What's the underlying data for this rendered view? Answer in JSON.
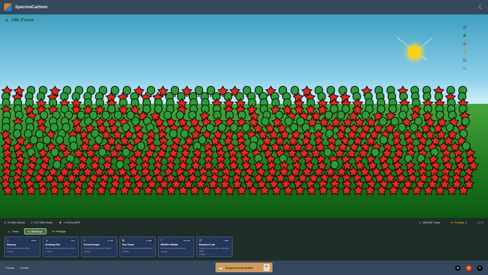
{
  "app": {
    "name": "SparrowCartoon",
    "theme_icon": "moon-icon"
  },
  "scene": {
    "title": "Idle Forest",
    "workers": [
      "lumberjack-icon",
      "forester-icon",
      "gatherer-icon",
      "sapling-icon",
      "ranger-icon",
      "scientist-icon"
    ],
    "tree_colors": {
      "green": "#2d9b3a",
      "red": "#e02a1e",
      "outline": "#0b0b0b"
    }
  },
  "stats": {
    "seeds": "72.09M Seeds",
    "wood": "127.94M Wood",
    "wps": "1.97M/s WPS",
    "trees": "300/300 Trees",
    "prestige": "Prestige 0",
    "prestige_bonus": "+1.97"
  },
  "tabs": [
    {
      "label": "Trees",
      "icon": "tree-icon",
      "active": false
    },
    {
      "label": "Buildings",
      "icon": "building-icon",
      "active": true
    },
    {
      "label": "Prestige",
      "icon": "star-icon",
      "active": false
    }
  ],
  "buildings": [
    {
      "icon": "nursery-icon",
      "name": "Nursery",
      "desc": "Grows saplings over time",
      "cost": "35.0K",
      "owned": "x1.00/s"
    },
    {
      "icon": "sapling-icon",
      "name": "Seeding Plot",
      "desc": "Plants seeds to yield more wood",
      "cost": "2.1M",
      "owned": "x1.01/s"
    },
    {
      "icon": "keeper-icon",
      "name": "Forest Keeper",
      "desc": "Tends forest so it grows faster",
      "cost": "10.4M",
      "owned": "x1.01/s"
    },
    {
      "icon": "ray-icon",
      "name": "Sun Tower",
      "desc": "Boosts photosynthesis of all trees",
      "cost": "42.8M",
      "owned": "x1.00/s"
    },
    {
      "icon": "wildlife-icon",
      "name": "Wildlife Habitat",
      "desc": "Animals help spread seeds",
      "cost": "210.4M",
      "owned": "x1.00/s"
    },
    {
      "icon": "lab-icon",
      "name": "Research Lab",
      "desc": "Studies trees to unlock upgrades faster",
      "cost": "1.06B",
      "owned": "x1.00/s"
    }
  ],
  "footer": {
    "links": [
      "Privacy",
      "Credits"
    ],
    "support_label": "Support local wildlife",
    "socials": [
      "github-icon",
      "reddit-icon",
      "x-icon"
    ]
  }
}
